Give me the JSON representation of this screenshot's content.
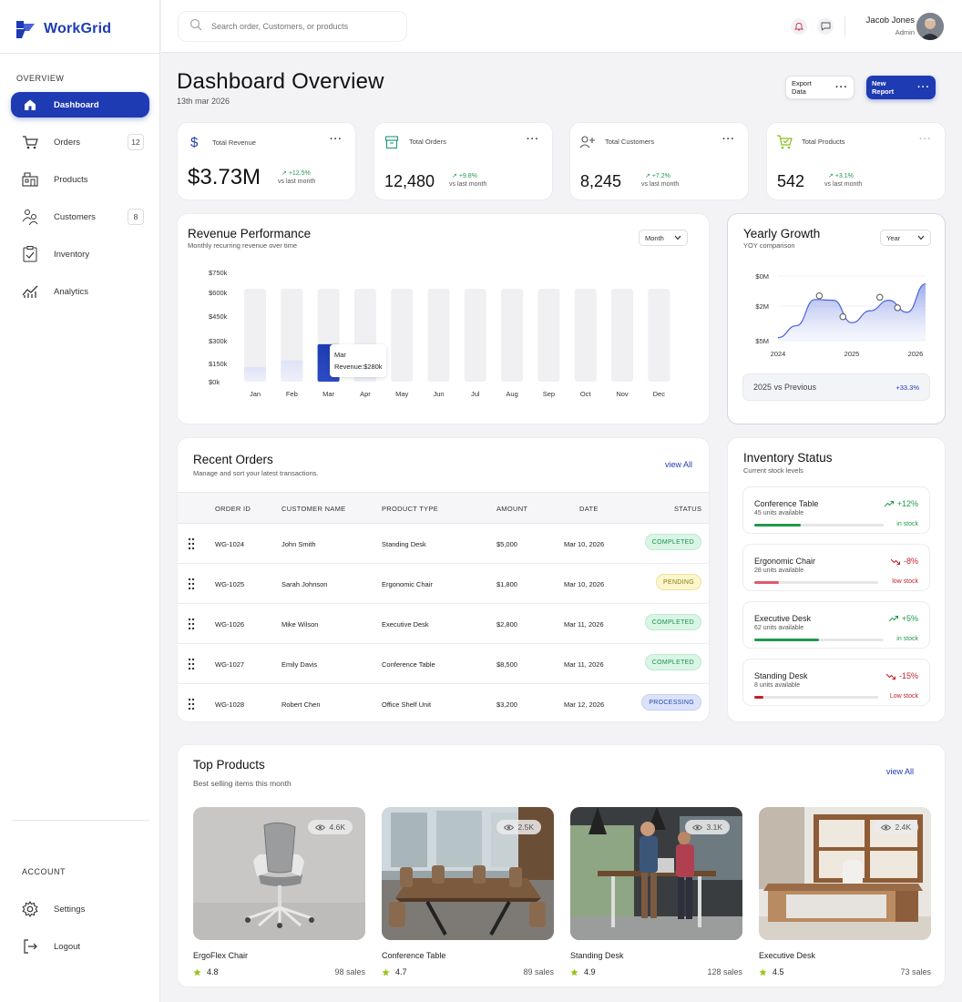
{
  "brand": {
    "name": "WorkGrid",
    "accent": "#1e3bb3"
  },
  "sidebar": {
    "overview_label": "OVERVIEW",
    "account_label": "ACCOUNT",
    "items": [
      {
        "label": "Dashboard",
        "icon": "home-icon",
        "active": true
      },
      {
        "label": "Orders",
        "icon": "cart-icon",
        "badge": "12"
      },
      {
        "label": "Products",
        "icon": "store-icon"
      },
      {
        "label": "Customers",
        "icon": "users-icon",
        "badge": "8"
      },
      {
        "label": "Inventory",
        "icon": "clipboard-check-icon"
      },
      {
        "label": "Analytics",
        "icon": "analytics-icon"
      }
    ],
    "account_items": [
      {
        "label": "Settings",
        "icon": "gear-icon"
      },
      {
        "label": "Logout",
        "icon": "logout-icon"
      }
    ]
  },
  "topbar": {
    "search_placeholder": "Search order, Customers, or products",
    "user_name": "Jacob Jones",
    "user_role": "Admin"
  },
  "page": {
    "title": "Dashboard Overview",
    "date": "13th mar 2026",
    "export_label": "Export Data",
    "new_report_label": "New Report"
  },
  "stats": [
    {
      "label": "Total Revenue",
      "value": "$3.73M",
      "change": "+12.5%",
      "vs": "vs last month",
      "icon": "dollar-icon"
    },
    {
      "label": "Total Orders",
      "value": "12,480",
      "change": "+9.8%",
      "vs": "vs last month",
      "icon": "box-icon"
    },
    {
      "label": "Total Customers",
      "value": "8,245",
      "change": "+7.2%",
      "vs": "vs last month",
      "icon": "user-add-icon"
    },
    {
      "label": "Total Products",
      "value": "542",
      "change": "+3.1%",
      "vs": "vs last month",
      "icon": "cart-check-icon"
    }
  ],
  "revenue": {
    "title": "Revenue Performance",
    "subtitle": "Monthly recurring revenue over time",
    "period": "Month",
    "tooltip_month": "Mar",
    "tooltip_value": "Revenue:$280k"
  },
  "growth": {
    "title": "Yearly Growth",
    "subtitle": "YOY comparison",
    "period": "Year",
    "compare_label": "2025 vs Previous",
    "compare_value": "+33.3%"
  },
  "chart_data": [
    {
      "type": "bar",
      "title": "Revenue Performance",
      "categories": [
        "Jan",
        "Feb",
        "Mar",
        "Apr",
        "May",
        "Jun",
        "Jul",
        "Aug",
        "Sep",
        "Oct",
        "Nov",
        "Dec"
      ],
      "values": [
        110,
        160,
        280,
        170,
        0,
        0,
        0,
        0,
        0,
        0,
        0,
        0
      ],
      "y_ticks": [
        "$0k",
        "$150k",
        "$300k",
        "$450k",
        "$600k",
        "$750k"
      ],
      "ylim": [
        0,
        750
      ],
      "highlight": "Mar",
      "highlight_color": "#1e3bb3"
    },
    {
      "type": "area",
      "title": "Yearly Growth",
      "x": [
        2024.0,
        2024.25,
        2024.5,
        2024.75,
        2025.0,
        2025.25,
        2025.5,
        2025.75,
        2026.0
      ],
      "values": [
        0.2,
        1.0,
        2.75,
        2.7,
        1.2,
        2.0,
        2.7,
        1.9,
        3.8
      ],
      "markers_at": [
        2024.56,
        2024.88,
        2025.38,
        2025.62
      ],
      "x_ticks": [
        "2024",
        "2025",
        "2026"
      ],
      "y_ticks": [
        "$0M",
        "$2M",
        "$5M"
      ],
      "color": "#4a63d8"
    }
  ],
  "orders": {
    "title": "Recent Orders",
    "subtitle": "Manage and sort your latest transactions.",
    "view_all": "view All",
    "columns": [
      "ORDER ID",
      "CUSTOMER NAME",
      "PRODUCT TYPE",
      "AMOUNT",
      "DATE",
      "STATUS"
    ],
    "rows": [
      {
        "id": "WG-1024",
        "customer": "John Smith",
        "product": "Standing Desk",
        "amount": "$5,000",
        "date": "Mar 10, 2026",
        "status": "COMPLETED",
        "status_class": "completed"
      },
      {
        "id": "WG-1025",
        "customer": "Sarah Johnson",
        "product": "Ergonomic Chair",
        "amount": "$1,800",
        "date": "Mar 10, 2026",
        "status": "PENDING",
        "status_class": "pending"
      },
      {
        "id": "WG-1026",
        "customer": "Mike Wilson",
        "product": "Executive Desk",
        "amount": "$2,800",
        "date": "Mar 11, 2026",
        "status": "COMPLETED",
        "status_class": "completed"
      },
      {
        "id": "WG-1027",
        "customer": "Emily Davis",
        "product": "Conference Table",
        "amount": "$8,500",
        "date": "Mar 11, 2026",
        "status": "COMPLETED",
        "status_class": "completed"
      },
      {
        "id": "WG-1028",
        "customer": "Robert Chen",
        "product": "Office Shelf Unit",
        "amount": "$3,200",
        "date": "Mar 12, 2026",
        "status": "PROCESSING",
        "status_class": "processing"
      }
    ]
  },
  "inventory": {
    "title": "Inventory Status",
    "subtitle": "Current stock levels",
    "items": [
      {
        "name": "Conference Table",
        "units": "45 units available",
        "change": "+12%",
        "trend": "up",
        "status": "in stock",
        "level": 0.36,
        "color": "#1f9a4b"
      },
      {
        "name": "Ergonomic Chair",
        "units": "28 units available",
        "change": "-8%",
        "trend": "down",
        "status": "low stock",
        "level": 0.2,
        "color": "#e05a6d"
      },
      {
        "name": "Executive Desk",
        "units": "62 units available",
        "change": "+5%",
        "trend": "up",
        "status": "in stock",
        "level": 0.5,
        "color": "#1f9a4b"
      },
      {
        "name": "Standing Desk",
        "units": "8 units available",
        "change": "-15%",
        "trend": "down",
        "status": "Low stock",
        "level": 0.07,
        "color": "#c01f2e"
      }
    ]
  },
  "top_products": {
    "title": "Top Products",
    "subtitle": "Best selling items this month",
    "view_all": "view All",
    "items": [
      {
        "name": "ErgoFlex Chair",
        "views": "4.6K",
        "rating": "4.8",
        "sales": "98 sales"
      },
      {
        "name": "Conference Table",
        "views": "2.5K",
        "rating": "4.7",
        "sales": "89 sales"
      },
      {
        "name": "Standing Desk",
        "views": "3.1K",
        "rating": "4.9",
        "sales": "128 sales"
      },
      {
        "name": "Executive Desk",
        "views": "2.4K",
        "rating": "4.5",
        "sales": "73 sales"
      }
    ]
  }
}
